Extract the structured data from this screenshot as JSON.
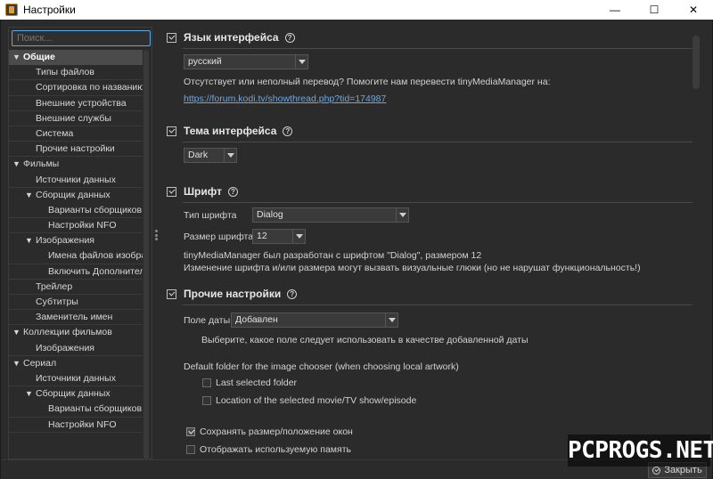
{
  "window": {
    "title": "Настройки",
    "min_label": "—",
    "max_label": "☐",
    "close_label": "✕"
  },
  "sidebar": {
    "search_placeholder": "Поиск...",
    "tree": [
      {
        "label": "Общие",
        "level": 0,
        "expanded": true,
        "selected": true
      },
      {
        "label": "Типы файлов",
        "level": 1
      },
      {
        "label": "Сортировка по названию",
        "level": 1
      },
      {
        "label": "Внешние устройства",
        "level": 1
      },
      {
        "label": "Внешние службы",
        "level": 1
      },
      {
        "label": "Система",
        "level": 1
      },
      {
        "label": "Прочие настройки",
        "level": 1
      },
      {
        "label": "Фильмы",
        "level": 0,
        "expanded": true
      },
      {
        "label": "Источники данных",
        "level": 1
      },
      {
        "label": "Сборщик данных",
        "level": 1,
        "expanded": true
      },
      {
        "label": "Варианты сборщиков д",
        "level": 2
      },
      {
        "label": "Настройки NFO",
        "level": 2
      },
      {
        "label": "Изображения",
        "level": 1,
        "expanded": true
      },
      {
        "label": "Имена файлов изобра",
        "level": 2
      },
      {
        "label": "Включить Дополнител",
        "level": 2
      },
      {
        "label": "Трейлер",
        "level": 1
      },
      {
        "label": "Субтитры",
        "level": 1
      },
      {
        "label": "Заменитель имен",
        "level": 1
      },
      {
        "label": "Коллекции фильмов",
        "level": 0,
        "expanded": true
      },
      {
        "label": "Изображения",
        "level": 1
      },
      {
        "label": "Сериал",
        "level": 0,
        "expanded": true
      },
      {
        "label": "Источники данных",
        "level": 1
      },
      {
        "label": "Сборщик данных",
        "level": 1,
        "expanded": true
      },
      {
        "label": "Варианты сборщиков д",
        "level": 2
      },
      {
        "label": "Настройки NFO",
        "level": 2
      }
    ]
  },
  "main": {
    "language": {
      "title": "Язык интерфейса",
      "value": "русский",
      "note": "Отсутствует или неполный перевод? Помогите нам перевести tinyMediaManager на:",
      "link": "https://forum.kodi.tv/showthread.php?tid=174987"
    },
    "theme": {
      "title": "Тема интерфейса",
      "value": "Dark"
    },
    "font": {
      "title": "Шрифт",
      "type_label": "Тип шрифта",
      "type_value": "Dialog",
      "size_label": "Размер шрифта",
      "size_value": "12",
      "note1": "tinyMediaManager был разработан с шрифтом \"Dialog\", размером 12",
      "note2": "Изменение шрифта и/или размера могут вызвать визуальные глюки (но не нарушат функциональность!)"
    },
    "other": {
      "title": "Прочие настройки",
      "date_label": "Поле даты",
      "date_value": "Добавлен",
      "date_hint": "Выберите, какое поле следует использовать в качестве добавленной даты",
      "folder_label": "Default folder for the image chooser (when choosing local artwork)",
      "opt_last": "Last selected folder",
      "opt_location": "Location of the selected movie/TV show/episode",
      "opt_save_window": "Сохранять размер/положение окон",
      "opt_show_memory": "Отображать используемую память"
    }
  },
  "footer": {
    "close_label": "Закрыть"
  },
  "watermark": "PCPROGS.NET",
  "colors": {
    "background": "#2b2b2b",
    "accent": "#5fa9e4",
    "link": "#6aa9e6"
  }
}
